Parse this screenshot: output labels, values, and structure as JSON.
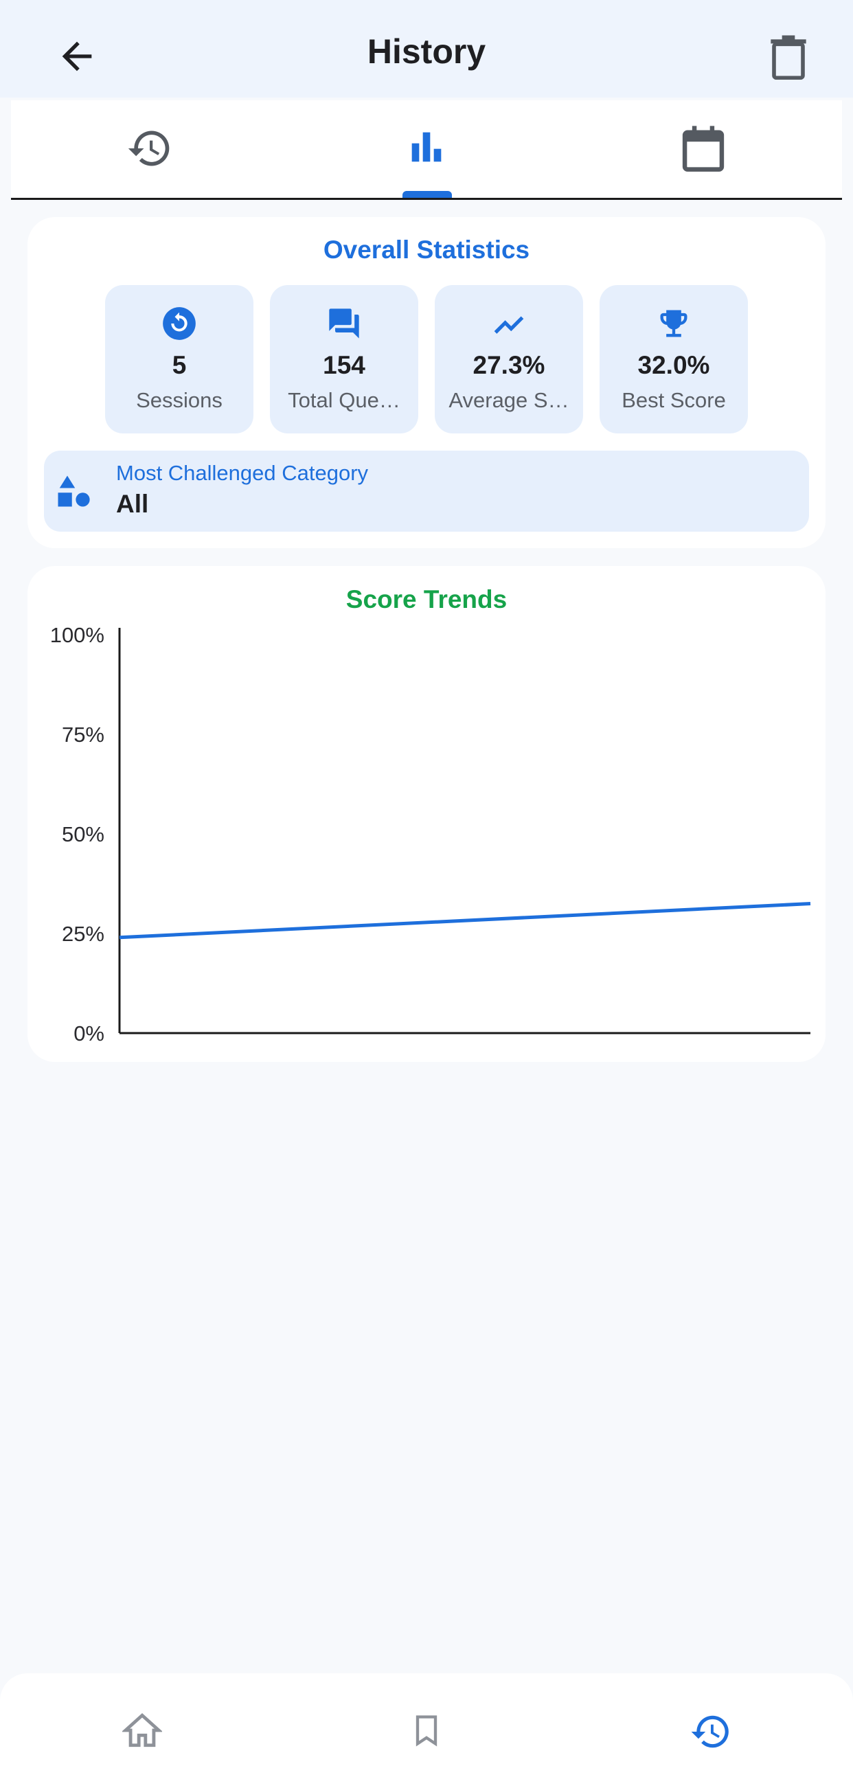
{
  "header": {
    "title": "History"
  },
  "tabs": [
    {
      "icon": "history-icon",
      "active": false
    },
    {
      "icon": "bar-chart-icon",
      "active": true
    },
    {
      "icon": "calendar-icon",
      "active": false
    }
  ],
  "stats": {
    "title": "Overall Statistics",
    "tiles": [
      {
        "icon": "restart-icon",
        "value": "5",
        "label": "Sessions"
      },
      {
        "icon": "chat-bubbles-icon",
        "value": "154",
        "label": "Total Que…"
      },
      {
        "icon": "trending-up-icon",
        "value": "27.3%",
        "label": "Average S…"
      },
      {
        "icon": "trophy-icon",
        "value": "32.0%",
        "label": "Best Score"
      }
    ],
    "category": {
      "icon": "category-shapes-icon",
      "label": "Most Challenged Category",
      "value": "All"
    }
  },
  "trends": {
    "title": "Score Trends"
  },
  "chart_data": {
    "type": "line",
    "title": "Score Trends",
    "xlabel": "",
    "ylabel": "",
    "ylim": [
      0,
      100
    ],
    "y_ticks": [
      "0%",
      "25%",
      "50%",
      "75%",
      "100%"
    ],
    "y_tick_values": [
      0,
      25,
      50,
      75,
      100
    ],
    "grid": false,
    "series": [
      {
        "color": "#1e6fdc",
        "values": [
          24,
          32.5
        ]
      }
    ]
  },
  "bottom_nav": [
    {
      "icon": "home-icon",
      "active": false
    },
    {
      "icon": "bookmark-icon",
      "active": false
    },
    {
      "icon": "history-icon",
      "active": true
    }
  ],
  "colors": {
    "accent": "#1e6fdc",
    "trend_title": "#16a34a",
    "tile_bg": "#e6effc"
  }
}
